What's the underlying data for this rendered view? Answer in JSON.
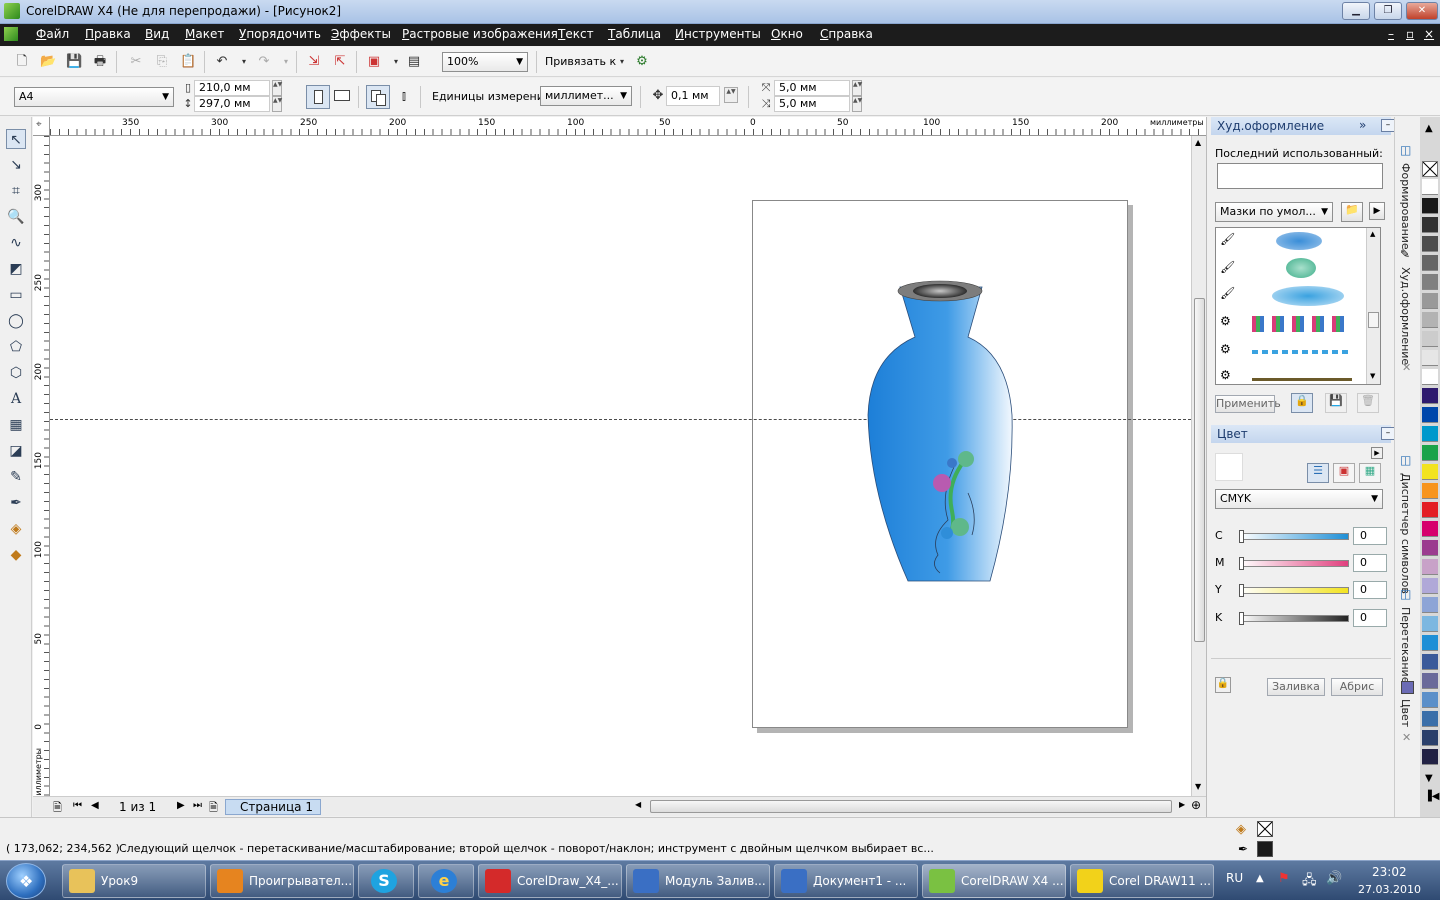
{
  "window": {
    "title": "CorelDRAW X4 (Не для перепродажи) - [Рисунок2]",
    "min": "▁",
    "max": "❐",
    "close": "✕"
  },
  "menu": [
    "Файл",
    "Правка",
    "Вид",
    "Макет",
    "Упорядочить",
    "Эффекты",
    "Растровые изображения",
    "Текст",
    "Таблица",
    "Инструменты",
    "Окно",
    "Справка"
  ],
  "menu_right": [
    "–",
    "▫",
    "×"
  ],
  "toolbar": {
    "zoom": "100%",
    "snap": "Привязать к"
  },
  "propbar": {
    "page_size": "A4",
    "width": "210,0 мм",
    "height": "297,0 мм",
    "units_label": "Единицы измерения:",
    "units_value": "миллимет...",
    "nudge": "0,1 мм",
    "dup_x": "5,0 мм",
    "dup_y": "5,0 мм"
  },
  "ruler": {
    "h_ticks": [
      "350",
      "300",
      "250",
      "200",
      "150",
      "100",
      "50",
      "0",
      "50",
      "100",
      "150",
      "200"
    ],
    "h_unit": "миллиметры",
    "v_ticks": [
      "300",
      "250",
      "200",
      "150",
      "100",
      "50",
      "0"
    ],
    "v_unit": "миллиметры"
  },
  "pages": {
    "counter": "1 из 1",
    "tab": "Страница 1"
  },
  "docker_art": {
    "title": "Худ.оформление",
    "recent_label": "Последний использованный:",
    "preset": "Мазки по умол...",
    "apply": "Применить"
  },
  "docker_color": {
    "title": "Цвет",
    "model": "CMYK",
    "channels": [
      {
        "label": "C",
        "value": "0",
        "color": "#1f8fd6"
      },
      {
        "label": "M",
        "value": "0",
        "color": "#e0407e"
      },
      {
        "label": "Y",
        "value": "0",
        "color": "#f2e320"
      },
      {
        "label": "K",
        "value": "0",
        "color": "#222222"
      }
    ],
    "fill": "Заливка",
    "outline": "Абрис"
  },
  "side_tabs": [
    "Формирование",
    "Худ.оформление",
    "Диспетчер символов",
    "Перетекание",
    "Цвет"
  ],
  "palette": [
    "#ffffff",
    "#1a1a1a",
    "#333333",
    "#4d4d4d",
    "#666666",
    "#808080",
    "#999999",
    "#b3b3b3",
    "#cccccc",
    "#e6e6e6",
    "#ffffff",
    "#2e1a6e",
    "#0047ab",
    "#0099cc",
    "#1aa34a",
    "#f2e320",
    "#f7941d",
    "#e31e24",
    "#d6006c",
    "#9b3b8f",
    "#c8a2c8",
    "#b0a8d8",
    "#8da4d6",
    "#7cb7e0",
    "#1f8fd6",
    "#3a5a9a",
    "#6a6a9a",
    "#5b8fc9",
    "#3b6fa9",
    "#2a3f6a",
    "#222244"
  ],
  "status": {
    "coords": "( 173,062; 234,562 )",
    "message": "Следующий щелчок - перетаскивание/масштабирование; второй щелчок - поворот/наклон; инструмент с двойным щелчком выбирает вс..."
  },
  "taskbar": {
    "items": [
      {
        "label": "Урок9",
        "color": "#e8c25a"
      },
      {
        "label": "Проигрывател...",
        "color": "#e6841f"
      },
      {
        "label": "",
        "color": "#1fa3e0"
      },
      {
        "label": "",
        "color": "#2c7fd6"
      },
      {
        "label": "CorelDraw_X4_...",
        "color": "#d42a2a"
      },
      {
        "label": "Модуль Залив...",
        "color": "#3a6fc4"
      },
      {
        "label": "Документ1 - ...",
        "color": "#3a6fc4"
      },
      {
        "label": "CorelDRAW X4 ...",
        "color": "#7ac142"
      },
      {
        "label": "Corel DRAW11 ...",
        "color": "#f2d21a"
      }
    ],
    "lang": "RU",
    "time": "23:02",
    "date": "27.03.2010"
  }
}
